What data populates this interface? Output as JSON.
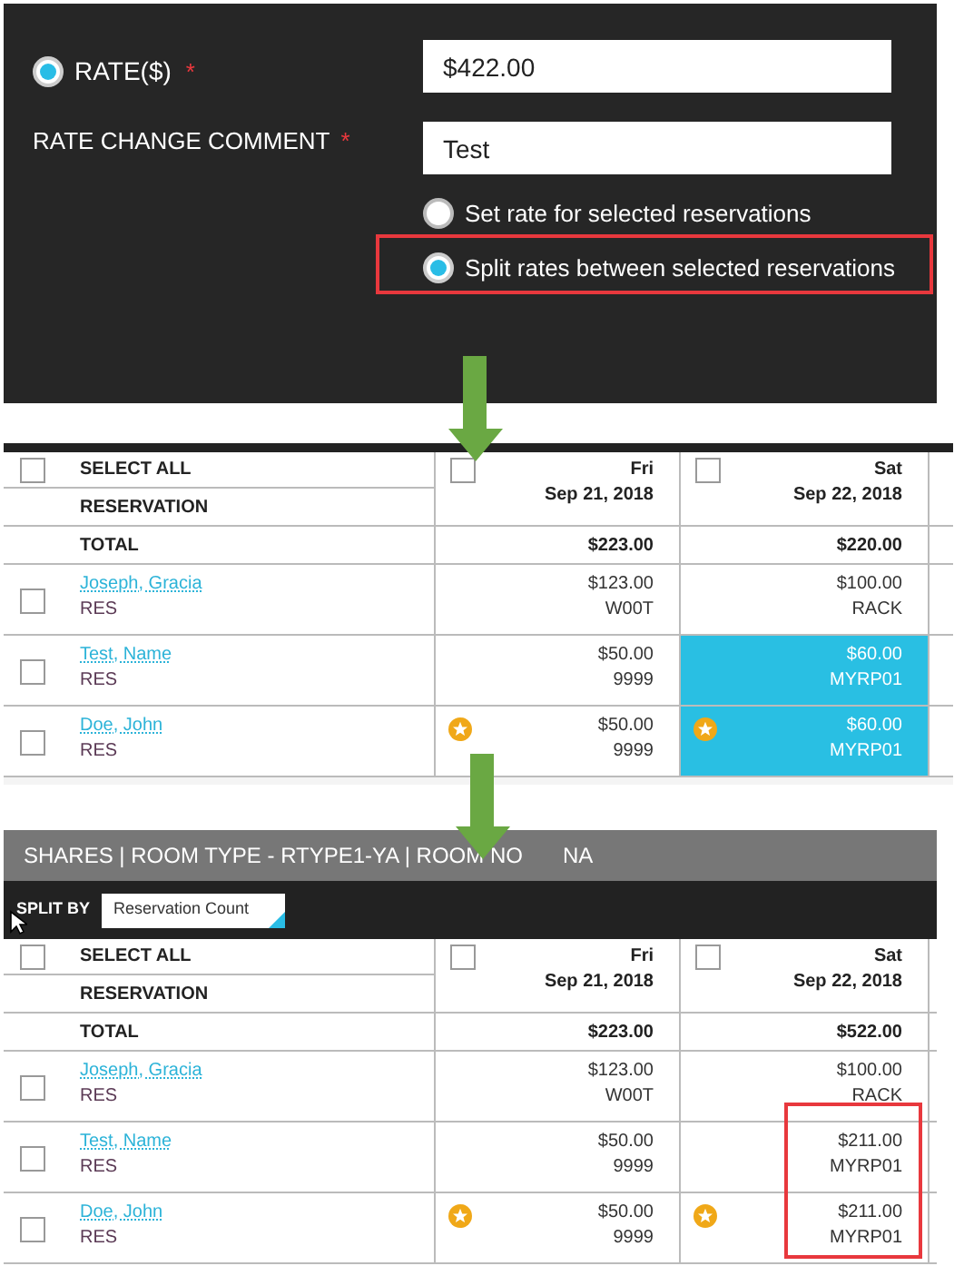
{
  "rate_form": {
    "rate_label": "RATE($)",
    "rate_selected": true,
    "rate_required": "*",
    "rate_value": "$422.00",
    "comment_label": "RATE CHANGE COMMENT",
    "comment_required": "*",
    "comment_value": "Test",
    "options": [
      {
        "label": "Set rate for selected reservations",
        "selected": false
      },
      {
        "label": "Split rates between selected reservations",
        "selected": true
      }
    ]
  },
  "grids": [
    {
      "select_all": {
        "label": "SELECT ALL",
        "checked": false
      },
      "reservation_label": "RESERVATION",
      "total_label": "TOTAL",
      "columns": [
        {
          "day": "Fri",
          "date": "Sep 21, 2018",
          "checked": false,
          "total": "$223.00"
        },
        {
          "day": "Sat",
          "date": "Sep 22, 2018",
          "checked": false,
          "total": "$220.00"
        }
      ],
      "rows": [
        {
          "name": "Joseph, Gracia",
          "type": "RES",
          "checked": false,
          "cells": [
            {
              "amount": "$123.00",
              "code": "W00T",
              "starred": false,
              "highlighted": false
            },
            {
              "amount": "$100.00",
              "code": "RACK",
              "starred": false,
              "highlighted": false
            }
          ]
        },
        {
          "name": "Test, Name",
          "type": "RES",
          "checked": false,
          "cells": [
            {
              "amount": "$50.00",
              "code": "9999",
              "starred": false,
              "highlighted": false
            },
            {
              "amount": "$60.00",
              "code": "MYRP01",
              "starred": false,
              "highlighted": true
            }
          ]
        },
        {
          "name": "Doe, John",
          "type": "RES",
          "checked": false,
          "cells": [
            {
              "amount": "$50.00",
              "code": "9999",
              "starred": true,
              "highlighted": false
            },
            {
              "amount": "$60.00",
              "code": "MYRP01",
              "starred": true,
              "highlighted": true
            }
          ]
        }
      ]
    },
    {
      "title": "SHARES | ROOM TYPE - RTYPE1-YA | ROOM NO",
      "title_tail": "NA",
      "split_by_label": "SPLIT BY",
      "split_by_value": "Reservation Count",
      "select_all": {
        "label": "SELECT ALL",
        "checked": false
      },
      "reservation_label": "RESERVATION",
      "total_label": "TOTAL",
      "columns": [
        {
          "day": "Fri",
          "date": "Sep 21, 2018",
          "checked": false,
          "total": "$223.00"
        },
        {
          "day": "Sat",
          "date": "Sep 22, 2018",
          "checked": false,
          "total": "$522.00"
        }
      ],
      "rows": [
        {
          "name": "Joseph, Gracia",
          "type": "RES",
          "checked": false,
          "cells": [
            {
              "amount": "$123.00",
              "code": "W00T",
              "starred": false,
              "highlighted": false
            },
            {
              "amount": "$100.00",
              "code": "RACK",
              "starred": false,
              "highlighted": false
            }
          ]
        },
        {
          "name": "Test, Name",
          "type": "RES",
          "checked": false,
          "cells": [
            {
              "amount": "$50.00",
              "code": "9999",
              "starred": false,
              "highlighted": false
            },
            {
              "amount": "$211.00",
              "code": "MYRP01",
              "starred": false,
              "highlighted": false
            }
          ]
        },
        {
          "name": "Doe, John",
          "type": "RES",
          "checked": false,
          "cells": [
            {
              "amount": "$50.00",
              "code": "9999",
              "starred": true,
              "highlighted": false
            },
            {
              "amount": "$211.00",
              "code": "MYRP01",
              "starred": true,
              "highlighted": false
            }
          ]
        }
      ]
    }
  ]
}
